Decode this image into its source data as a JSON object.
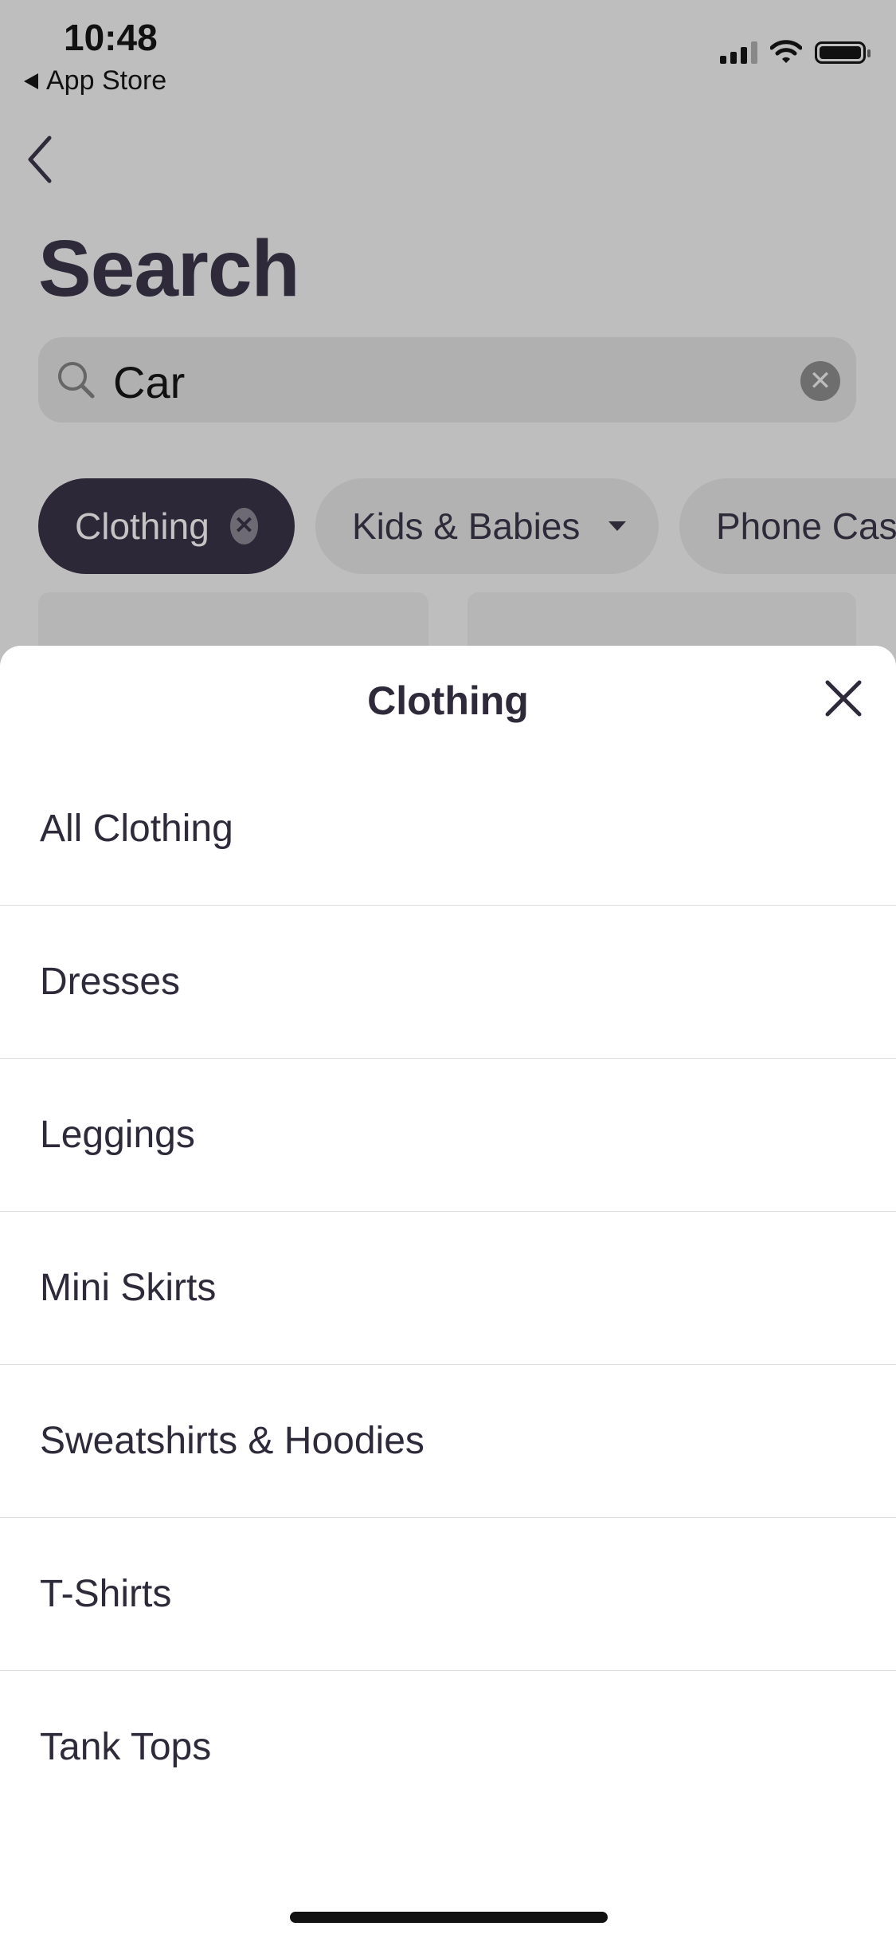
{
  "status_bar": {
    "time": "10:48",
    "back_app": "App Store",
    "icons": [
      "signal-icon",
      "wifi-icon",
      "battery-icon"
    ]
  },
  "header": {
    "title": "Search"
  },
  "search": {
    "value": "Car",
    "icon": "search-icon"
  },
  "chips": [
    {
      "label": "Clothing",
      "active": true
    },
    {
      "label": "Kids & Babies",
      "active": false
    },
    {
      "label": "Phone Cases",
      "active": false
    }
  ],
  "sheet": {
    "title": "Clothing",
    "items": [
      {
        "label": "All Clothing"
      },
      {
        "label": "Dresses"
      },
      {
        "label": "Leggings"
      },
      {
        "label": "Mini Skirts"
      },
      {
        "label": "Sweatshirts & Hoodies"
      },
      {
        "label": "T-Shirts"
      },
      {
        "label": "Tank Tops"
      }
    ]
  },
  "colors": {
    "primary": "#2d2838",
    "overlay": "#bebebe",
    "sheet": "#ffffff"
  }
}
